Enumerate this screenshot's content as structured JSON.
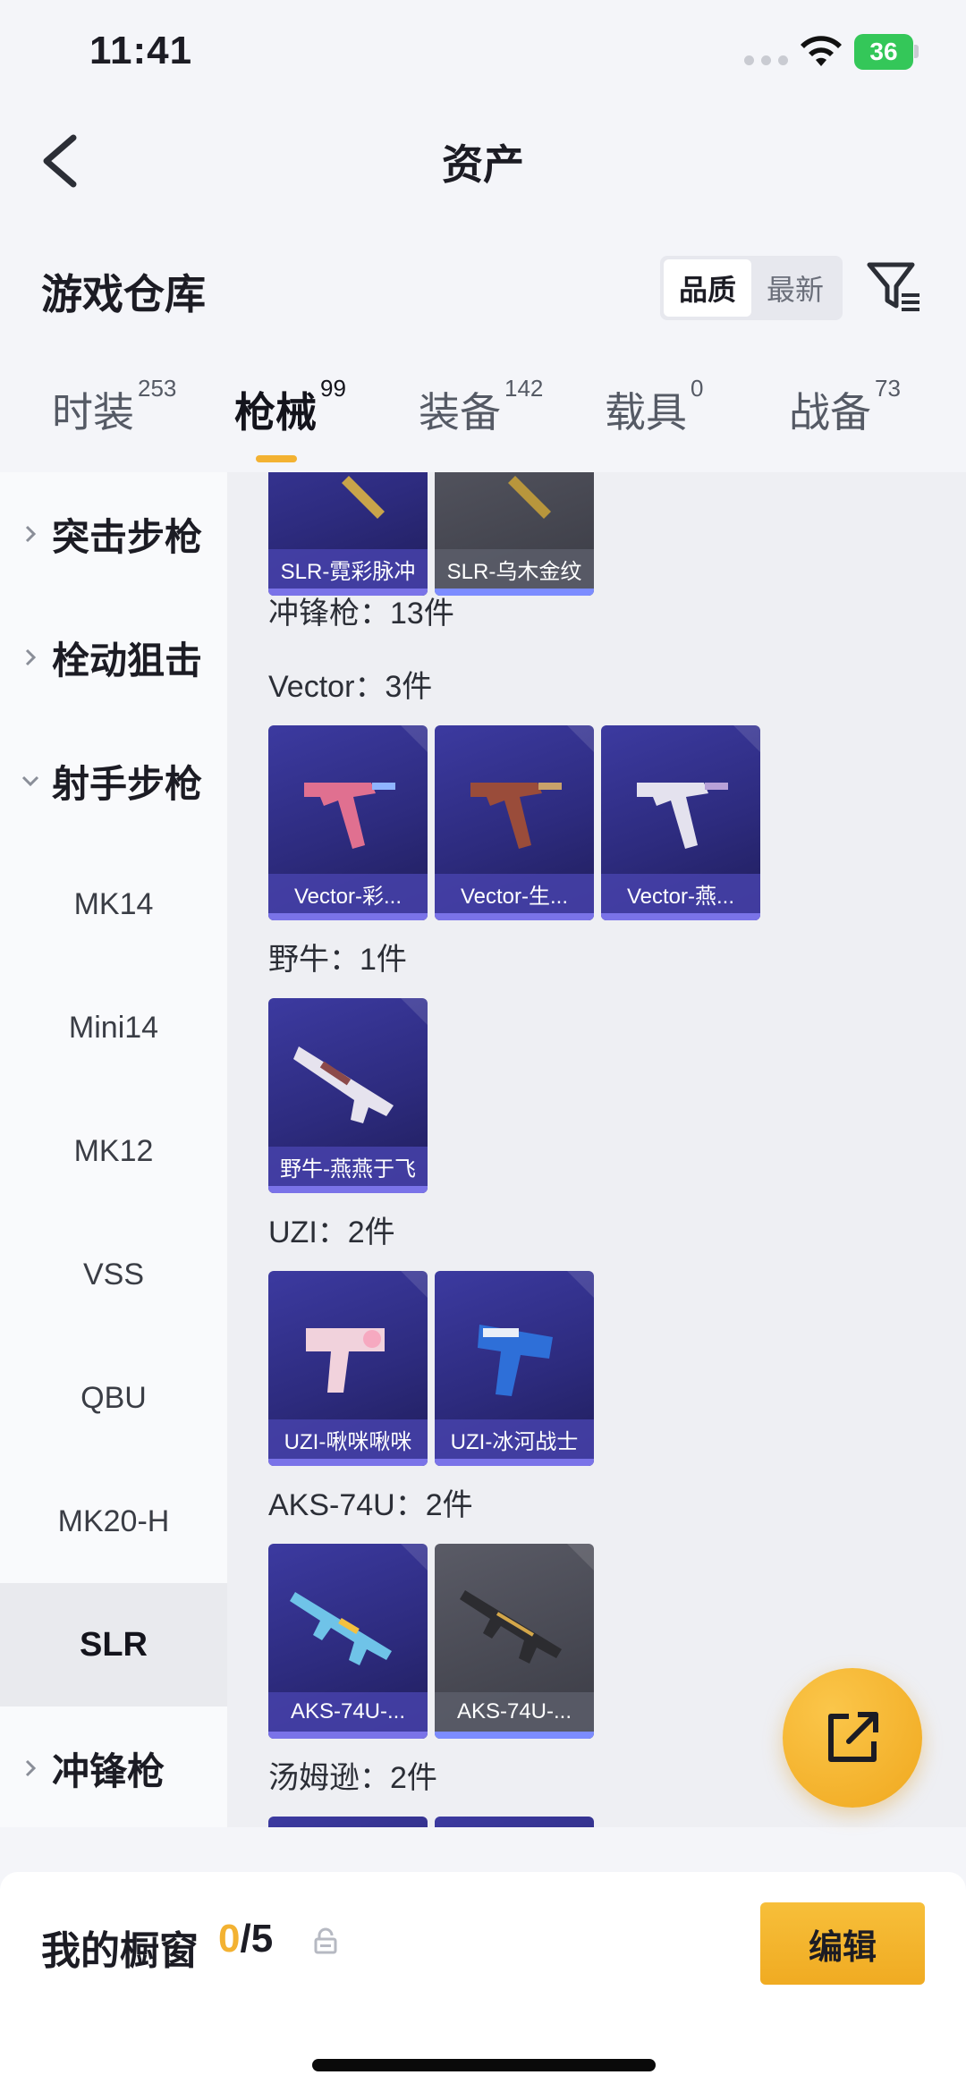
{
  "status_bar": {
    "time": "11:41",
    "battery": "36"
  },
  "header": {
    "title": "资产"
  },
  "warehouse": {
    "title": "游戏仓库",
    "sort_options": [
      "品质",
      "最新"
    ],
    "active_sort": "品质"
  },
  "tabs": [
    {
      "label": "时装",
      "count": "253"
    },
    {
      "label": "枪械",
      "count": "99"
    },
    {
      "label": "装备",
      "count": "142"
    },
    {
      "label": "载具",
      "count": "0"
    },
    {
      "label": "战备",
      "count": "73"
    }
  ],
  "active_tab": "枪械",
  "sidebar": {
    "groups": [
      {
        "label": "突击步枪"
      },
      {
        "label": "栓动狙击"
      },
      {
        "label": "射手步枪"
      },
      {
        "label": "冲锋枪"
      }
    ],
    "sub_items": [
      "MK14",
      "Mini14",
      "MK12",
      "VSS",
      "QBU",
      "MK20-H",
      "SLR"
    ],
    "selected": "SLR"
  },
  "content": {
    "top_items": [
      "SLR-霓彩脉冲",
      "SLR-乌木金纹"
    ],
    "category_heading": "冲锋枪：13件",
    "sections": [
      {
        "heading": "Vector：3件",
        "items": [
          "Vector-彩...",
          "Vector-生...",
          "Vector-燕..."
        ]
      },
      {
        "heading": "野牛：1件",
        "items": [
          "野牛-燕燕于飞"
        ]
      },
      {
        "heading": "UZI：2件",
        "items": [
          "UZI-啾咪啾咪",
          "UZI-冰河战士"
        ]
      },
      {
        "heading": "AKS-74U：2件",
        "items": [
          "AKS-74U-...",
          "AKS-74U-..."
        ]
      },
      {
        "heading": "汤姆逊：2件",
        "items": []
      }
    ]
  },
  "showcase": {
    "title": "我的橱窗",
    "current": "0",
    "total": "/5",
    "edit_label": "编辑"
  },
  "colors": {
    "accent": "#f3b232",
    "card_purple": "#3c3aa0",
    "card_gray": "#5a5b66"
  }
}
